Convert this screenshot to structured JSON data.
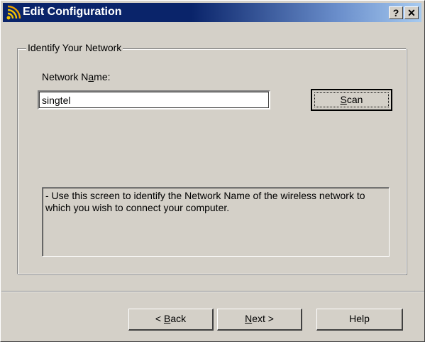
{
  "window": {
    "title": "Edit Configuration",
    "title_icon": "wireless-signal-icon",
    "help_glyph": "?",
    "close_glyph": "✕"
  },
  "group": {
    "legend": "Identify Your Network"
  },
  "network_name": {
    "label_pre": "Network N",
    "label_mnemonic": "a",
    "label_post": "me:",
    "value": "singtel"
  },
  "scan_button": {
    "mnemonic": "S",
    "rest": "can"
  },
  "info": {
    "text": "- Use this screen to identify the Network Name of the wireless network to which you wish to connect your computer."
  },
  "nav": {
    "back_pre": "< ",
    "back_mnemonic": "B",
    "back_post": "ack",
    "next_mnemonic": "N",
    "next_post": "ext >",
    "help_label": "Help"
  },
  "colors": {
    "title_bar": "#0a246a",
    "dialog_face": "#d4d0c8"
  }
}
